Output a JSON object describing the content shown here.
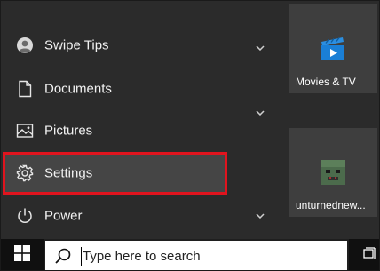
{
  "start_menu": {
    "items": [
      {
        "label": "Swipe Tips",
        "icon": "user-account-icon"
      },
      {
        "label": "Documents",
        "icon": "document-icon"
      },
      {
        "label": "Pictures",
        "icon": "pictures-icon"
      },
      {
        "label": "Settings",
        "icon": "gear-icon",
        "selected": true
      },
      {
        "label": "Power",
        "icon": "power-icon"
      }
    ],
    "highlight_color": "#e0141e"
  },
  "tiles": [
    {
      "label": "Movies & TV",
      "icon": "movies-tv-icon"
    },
    {
      "label": "unturnednew...",
      "icon": "game-icon"
    }
  ],
  "taskbar": {
    "search_placeholder": "Type here to search",
    "start_icon": "windows-logo-icon",
    "task_view_icon": "task-view-icon"
  }
}
